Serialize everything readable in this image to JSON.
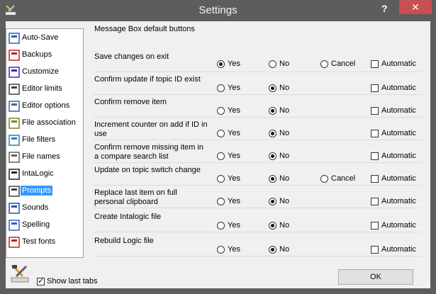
{
  "window": {
    "title": "Settings",
    "help_label": "?",
    "close_label": "✕"
  },
  "nav": {
    "items": [
      {
        "label": "Auto-Save",
        "icon": "floppy-icon"
      },
      {
        "label": "Backups",
        "icon": "backup-icon"
      },
      {
        "label": "Customize",
        "icon": "customize-check-icon"
      },
      {
        "label": "Editor limits",
        "icon": "editor-limits-icon"
      },
      {
        "label": "Editor options",
        "icon": "editor-options-icon"
      },
      {
        "label": "File association",
        "icon": "file-association-icon"
      },
      {
        "label": "File filters",
        "icon": "file-filters-icon"
      },
      {
        "label": "File names",
        "icon": "file-names-icon"
      },
      {
        "label": "IntaLogic",
        "icon": "intalogic-icon"
      },
      {
        "label": "Prompts",
        "icon": "prompts-icon"
      },
      {
        "label": "Sounds",
        "icon": "sounds-icon"
      },
      {
        "label": "Spelling",
        "icon": "spelling-icon"
      },
      {
        "label": "Test fonts",
        "icon": "test-fonts-icon"
      }
    ],
    "selected": "Prompts"
  },
  "group": {
    "title": "Message Box default buttons",
    "yes_label": "Yes",
    "no_label": "No",
    "cancel_label": "Cancel",
    "automatic_label": "Automatic",
    "rows": [
      {
        "label": "Save changes on exit",
        "selected": "Yes",
        "has_cancel": true,
        "automatic": false
      },
      {
        "label": "Confirm update if topic ID exist",
        "selected": "No",
        "has_cancel": false,
        "automatic": false
      },
      {
        "label": "Confirm remove item",
        "selected": "No",
        "has_cancel": false,
        "automatic": false
      },
      {
        "label": "Increment counter on add if ID in use",
        "selected": "No",
        "has_cancel": false,
        "automatic": false
      },
      {
        "label": "Confirm remove missing item in a compare search list",
        "selected": "No",
        "has_cancel": false,
        "automatic": false
      },
      {
        "label": "Update on topic switch change",
        "selected": "No",
        "has_cancel": true,
        "automatic": false
      },
      {
        "label": "Replace last item on full personal clipboard",
        "selected": "No",
        "has_cancel": false,
        "automatic": false
      },
      {
        "label": "Create Intalogic file",
        "selected": "No",
        "has_cancel": false,
        "automatic": false
      },
      {
        "label": "Rebuild Logic file",
        "selected": "No",
        "has_cancel": false,
        "automatic": false
      }
    ]
  },
  "footer": {
    "show_last_tabs_label": "Show last tabs",
    "show_last_tabs_checked": true,
    "ok_label": "OK"
  }
}
